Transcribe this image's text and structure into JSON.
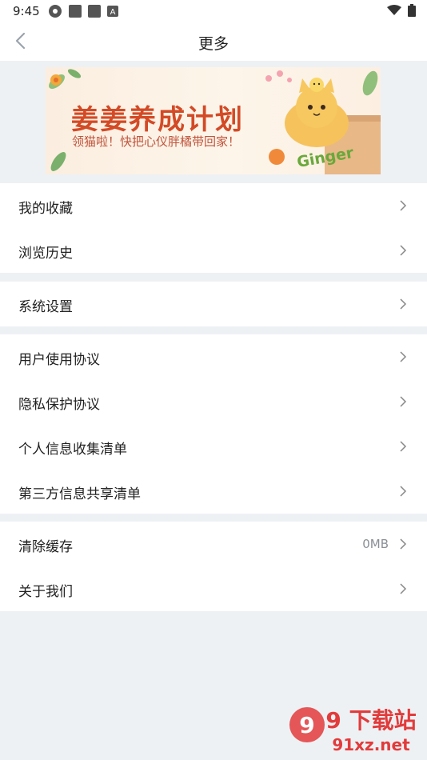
{
  "status": {
    "time": "9:45",
    "left_icons": [
      "aperture-icon",
      "notification-icon",
      "notification-icon",
      "a-icon"
    ],
    "right_icons": [
      "wifi-icon",
      "battery-icon"
    ]
  },
  "header": {
    "title": "更多",
    "back_icon": "chevron-left-icon"
  },
  "banner": {
    "title": "姜姜养成计划",
    "subtitle": "领猫啦！快把心仪胖橘带回家！",
    "brand": "Ginger"
  },
  "groups": [
    {
      "items": [
        {
          "label": "我的收藏"
        },
        {
          "label": "浏览历史"
        }
      ]
    },
    {
      "items": [
        {
          "label": "系统设置"
        }
      ]
    },
    {
      "items": [
        {
          "label": "用户使用协议"
        },
        {
          "label": "隐私保护协议"
        },
        {
          "label": "个人信息收集清单"
        },
        {
          "label": "第三方信息共享清单"
        }
      ]
    },
    {
      "items": [
        {
          "label": "清除缓存",
          "value": "0MB"
        },
        {
          "label": "关于我们"
        }
      ]
    }
  ],
  "watermark": {
    "text": "9 下载站",
    "url": "91xz.net"
  },
  "colors": {
    "background": "#eef1f4",
    "accent": "#d34a26",
    "chevron": "#888888"
  }
}
